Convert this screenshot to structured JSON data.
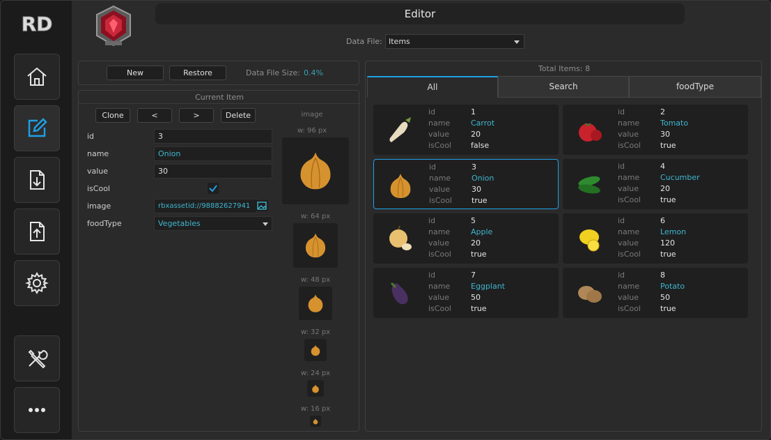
{
  "window": {
    "title": "Editor",
    "logo_text": "RD"
  },
  "sidebar": {
    "items": [
      {
        "icon": "home-icon"
      },
      {
        "icon": "edit-icon",
        "active": true
      },
      {
        "icon": "download-icon"
      },
      {
        "icon": "upload-icon"
      },
      {
        "icon": "gear-icon"
      },
      {
        "icon": "tools-icon"
      },
      {
        "icon": "more-icon"
      }
    ]
  },
  "data_file": {
    "label": "Data File:",
    "selected": "Items"
  },
  "toolbar": {
    "new_label": "New",
    "restore_label": "Restore",
    "size_label": "Data File Size:",
    "size_value": "0.4%"
  },
  "current_item": {
    "title": "Current Item",
    "buttons": {
      "clone": "Clone",
      "prev": "<",
      "next": ">",
      "delete": "Delete"
    },
    "fields": {
      "id_label": "id",
      "id_value": "3",
      "name_label": "name",
      "name_value": "Onion",
      "value_label": "value",
      "value_value": "30",
      "iscool_label": "isCool",
      "iscool_value": true,
      "image_label": "image",
      "image_value": "rbxassetid://98882627941",
      "foodtype_label": "foodType",
      "foodtype_value": "Vegetables"
    },
    "image_column": {
      "title": "image",
      "sizes": [
        "w: 96 px",
        "w: 64 px",
        "w: 48 px",
        "w: 32 px",
        "w: 24 px",
        "w: 16 px"
      ]
    }
  },
  "list": {
    "total": "Total Items: 8",
    "tabs": [
      "All",
      "Search",
      "foodType"
    ],
    "keys": {
      "id": "id",
      "name": "name",
      "value": "value",
      "iscool": "isCool"
    },
    "items": [
      {
        "id": "1",
        "name": "Carrot",
        "value": "20",
        "isCool": "false",
        "icon": "carrot-icon",
        "color": "#e8dcc0"
      },
      {
        "id": "2",
        "name": "Tomato",
        "value": "30",
        "isCool": "true",
        "icon": "tomato-icon",
        "color": "#c8222c"
      },
      {
        "id": "3",
        "name": "Onion",
        "value": "30",
        "isCool": "true",
        "icon": "onion-icon",
        "color": "#d6922e"
      },
      {
        "id": "4",
        "name": "Cucumber",
        "value": "20",
        "isCool": "true",
        "icon": "cucumber-icon",
        "color": "#2e8a2e"
      },
      {
        "id": "5",
        "name": "Apple",
        "value": "20",
        "isCool": "true",
        "icon": "apple-icon",
        "color": "#e8c070"
      },
      {
        "id": "6",
        "name": "Lemon",
        "value": "120",
        "isCool": "true",
        "icon": "lemon-icon",
        "color": "#f0d020"
      },
      {
        "id": "7",
        "name": "Eggplant",
        "value": "50",
        "isCool": "true",
        "icon": "eggplant-icon",
        "color": "#4a3060"
      },
      {
        "id": "8",
        "name": "Potato",
        "value": "50",
        "isCool": "true",
        "icon": "potato-icon",
        "color": "#b08858"
      }
    ]
  },
  "colors": {
    "accent": "#1ea0e6",
    "cyan_text": "#3fb6d0"
  }
}
